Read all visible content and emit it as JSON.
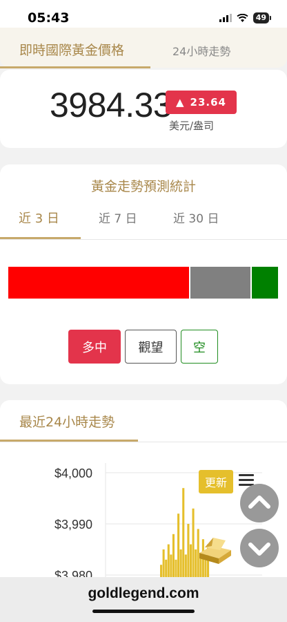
{
  "status": {
    "time": "05:43",
    "battery": "49"
  },
  "top_tabs": {
    "active": "即時國際黃金價格",
    "second": "24小時走勢"
  },
  "price": {
    "value": "3984.33",
    "change_arrow": "▲",
    "change": "23.64",
    "unit": "美元/盎司"
  },
  "forecast": {
    "title": "黃金走勢預測統計",
    "tabs": [
      "近 3 日",
      "近 7 日",
      "近 30 日"
    ],
    "bar": {
      "bull_fraction": 0.675,
      "neutral_fraction": 0.228,
      "bear_fraction": 0.097
    },
    "colors": {
      "bull": "#ff0000",
      "neutral": "#808080",
      "bear": "#008000"
    },
    "buttons": {
      "long": "多中",
      "watch": "觀望",
      "short": "空"
    }
  },
  "chart": {
    "title": "最近24小時走勢",
    "update_label": "更新",
    "chart_data": {
      "type": "area",
      "y_ticks": [
        "$4,000",
        "$3,990",
        "$3,980"
      ],
      "ylim": [
        3980,
        4000
      ],
      "series": [
        {
          "values": [
            3982,
            3985,
            3983,
            3986,
            3984,
            3988,
            3983,
            3992,
            3985,
            3997,
            3984,
            3990,
            3986,
            3993,
            3985,
            3989,
            3984,
            3987,
            3983,
            3986
          ]
        }
      ]
    }
  },
  "scroll": {
    "up_icon": "chevron-up-icon",
    "down_icon": "chevron-down-icon"
  },
  "footer": {
    "url": "goldlegend.com"
  }
}
